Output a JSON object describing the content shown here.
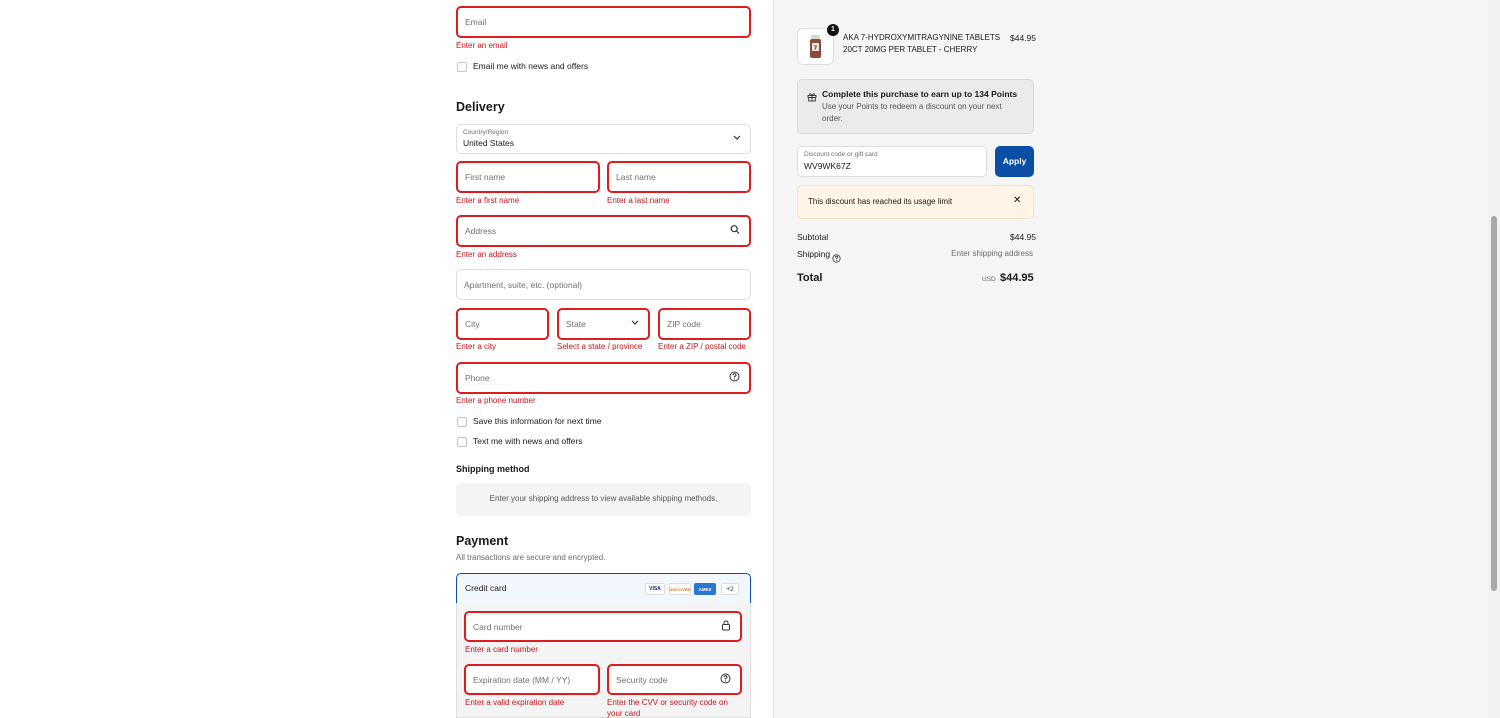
{
  "contact": {
    "email_placeholder": "Email",
    "email_error": "Enter an email",
    "news_label": "Email me with news and offers"
  },
  "delivery": {
    "heading": "Delivery",
    "country_label": "Country/Region",
    "country_value": "United States",
    "first_name_placeholder": "First name",
    "first_name_error": "Enter a first name",
    "last_name_placeholder": "Last name",
    "last_name_error": "Enter a last name",
    "address_placeholder": "Address",
    "address_error": "Enter an address",
    "apartment_placeholder": "Apartment, suite, etc. (optional)",
    "city_placeholder": "City",
    "city_error": "Enter a city",
    "state_placeholder": "State",
    "state_error": "Select a state / province",
    "zip_placeholder": "ZIP code",
    "zip_error": "Enter a ZIP / postal code",
    "phone_placeholder": "Phone",
    "phone_error": "Enter a phone number",
    "save_info_label": "Save this information for next time",
    "text_me_label": "Text me with news and offers"
  },
  "shipping_method": {
    "heading": "Shipping method",
    "message": "Enter your shipping address to view available shipping methods."
  },
  "payment": {
    "heading": "Payment",
    "subheading": "All transactions are secure and encrypted.",
    "method_label": "Credit card",
    "card_brands": [
      "VISA",
      "DISCOVER",
      "AMEX",
      "+2"
    ],
    "card_number_placeholder": "Card number",
    "card_number_error": "Enter a card number",
    "expiry_placeholder": "Expiration date (MM / YY)",
    "expiry_error": "Enter a valid expiration date",
    "security_placeholder": "Security code",
    "security_error_line1": "Enter the CVV or security code on",
    "security_error_line2": "your card"
  },
  "summary": {
    "item": {
      "quantity": "1",
      "name_line1": "AKA 7-HYDROXYMITRAGYNINE TABLETS",
      "name_line2": "20CT 20MG PER TABLET - CHERRY",
      "price": "$44.95"
    },
    "points": {
      "title": "Complete this purchase to earn up to 134 Points",
      "body_line1": "Use your Points to redeem a discount on your next",
      "body_line2": "order."
    },
    "discount": {
      "label": "Discount code or gift card",
      "value": "WV9WK67Z",
      "apply_label": "Apply",
      "notice": "This discount has reached its usage limit",
      "close_icon": "✕"
    },
    "subtotal_label": "Subtotal",
    "subtotal_value": "$44.95",
    "shipping_label": "Shipping",
    "shipping_value": "Enter shipping address",
    "total_label": "Total",
    "currency": "USD",
    "total_value": "$44.95"
  },
  "colors": {
    "error": "#dd1d1d",
    "apply_button": "#0a4ea6",
    "notice_bg": "#fff4e6"
  }
}
